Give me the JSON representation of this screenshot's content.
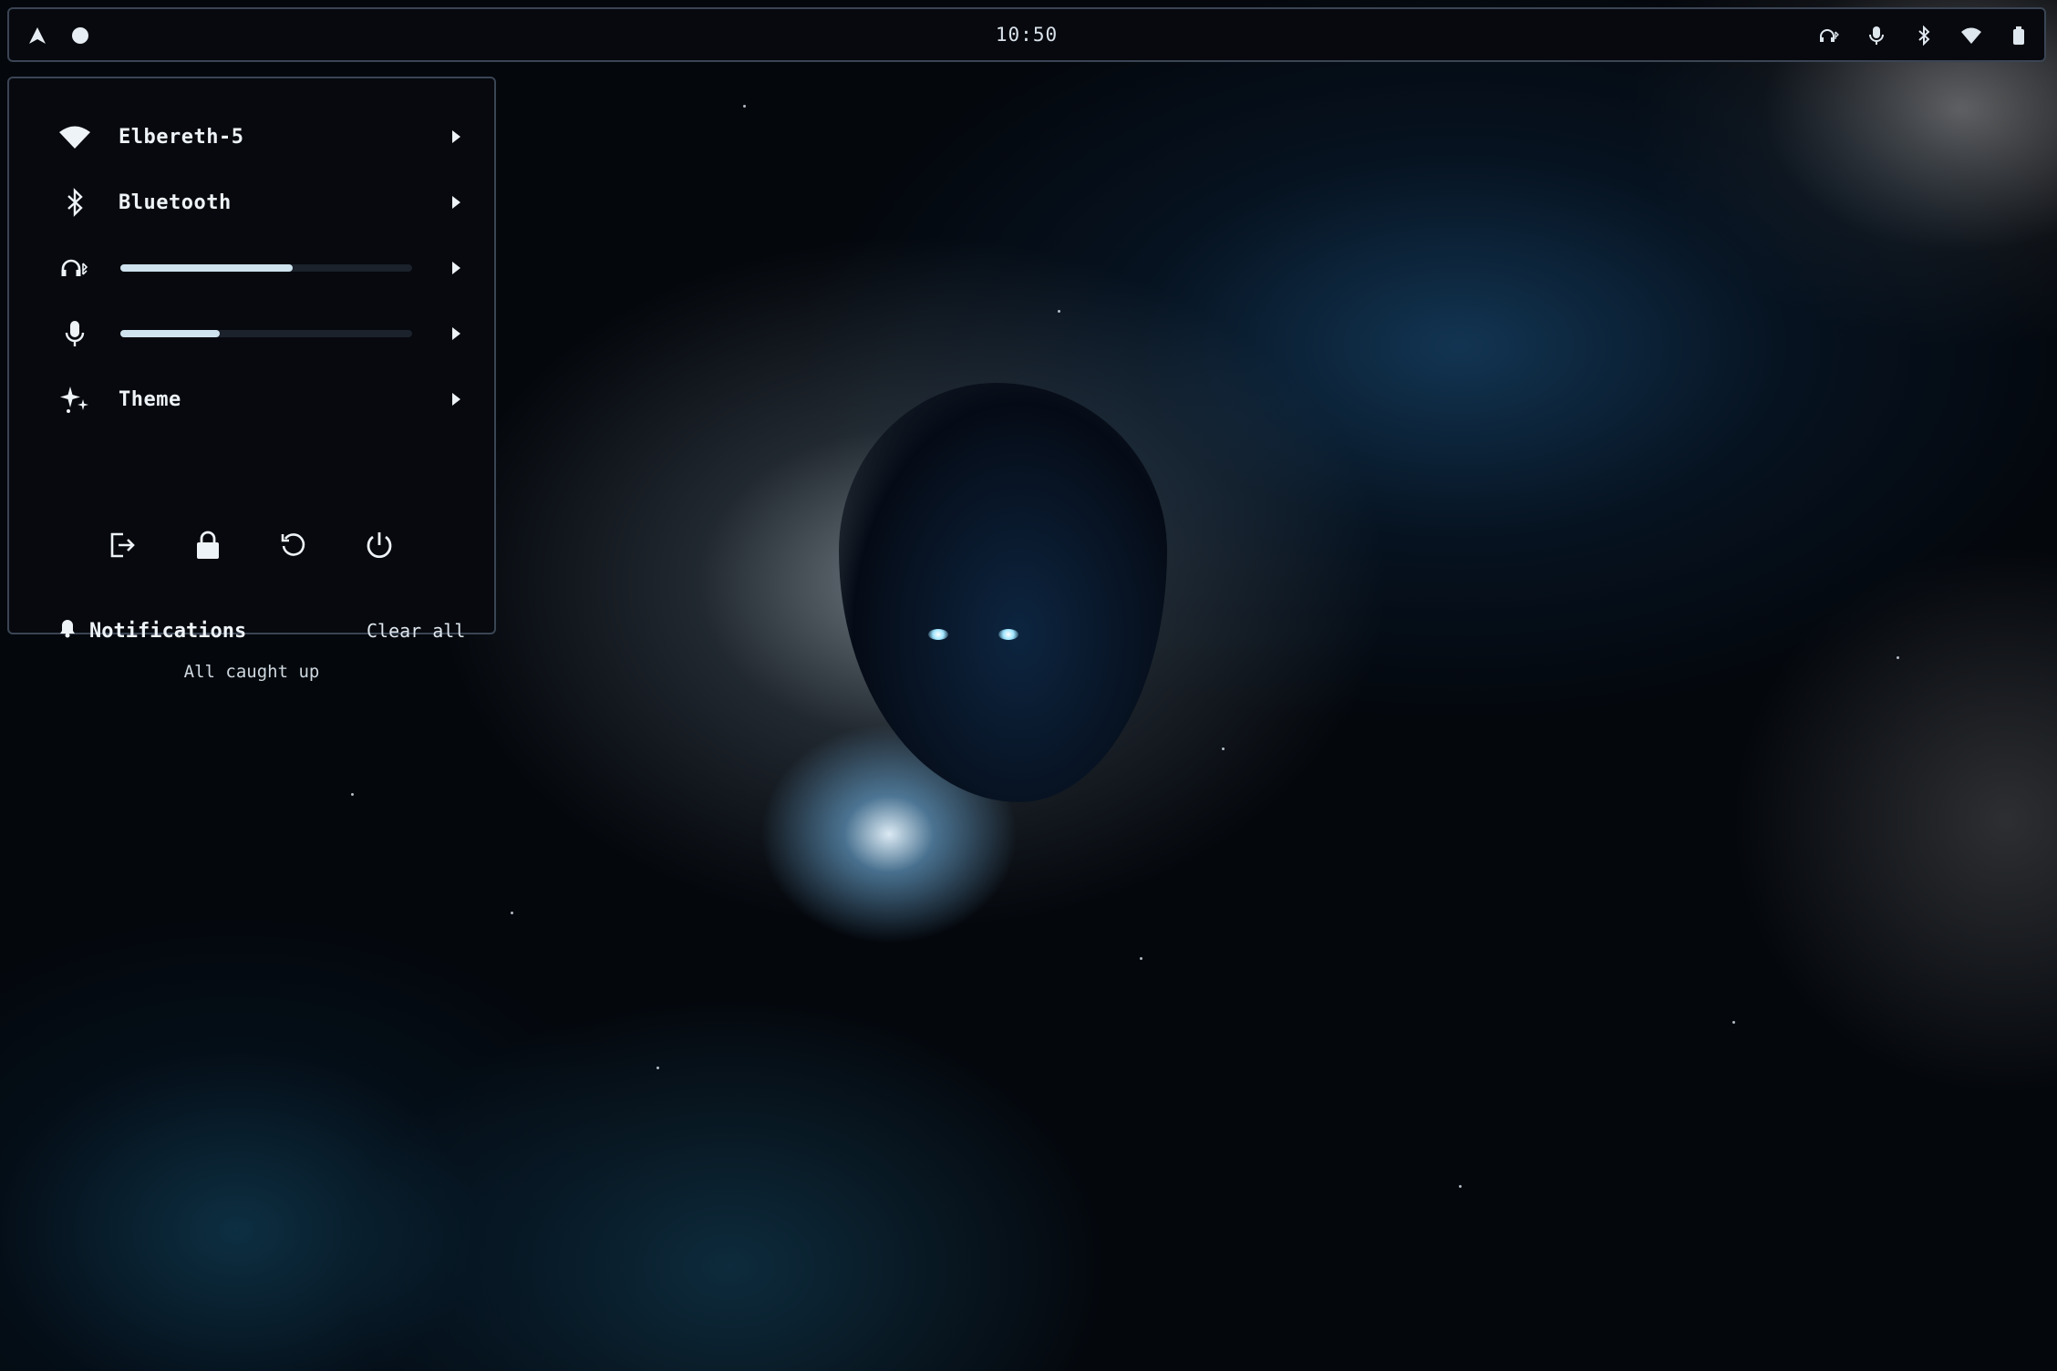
{
  "topbar": {
    "clock": "10:50",
    "left_icons": [
      "launcher-icon",
      "status-dot-icon"
    ],
    "tray_icons": [
      "bluetooth-headphones-icon",
      "microphone-icon",
      "bluetooth-icon",
      "wifi-icon",
      "battery-icon"
    ]
  },
  "panel": {
    "wifi": {
      "label": "Elbereth-5",
      "icon": "wifi-icon"
    },
    "bluetooth": {
      "label": "Bluetooth",
      "icon": "bluetooth-icon"
    },
    "output_volume": {
      "icon": "bluetooth-headphones-icon",
      "level": 0.59
    },
    "input_volume": {
      "icon": "microphone-icon",
      "level": 0.34
    },
    "theme": {
      "label": "Theme",
      "icon": "sparkles-icon"
    },
    "actions": [
      "logout-icon",
      "lock-icon",
      "restart-icon",
      "power-icon"
    ],
    "notifications": {
      "title": "Notifications",
      "clear_label": "Clear all",
      "empty_text": "All caught up"
    }
  },
  "colors": {
    "panel_bg": "#07090e",
    "border": "#3a4554",
    "slider_fill": "#cfe3ee",
    "slider_track": "#1b222c"
  }
}
